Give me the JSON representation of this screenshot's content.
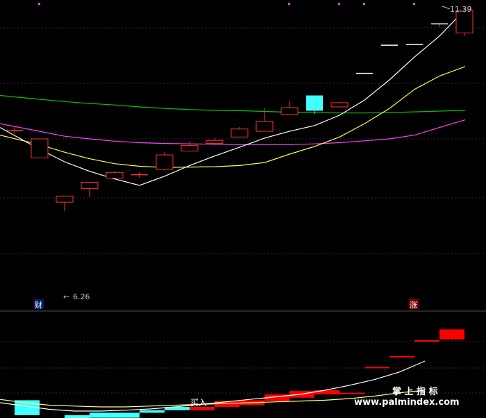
{
  "chart_data": {
    "type": "candlestick",
    "price_range": [
      4.0,
      11.6
    ],
    "candles": [
      {
        "o": 8.32,
        "h": 8.42,
        "l": 8.24,
        "c": 8.32
      },
      {
        "o": 7.6,
        "h": 8.1,
        "l": 7.6,
        "c": 8.1
      },
      {
        "o": 6.44,
        "h": 6.6,
        "l": 6.2,
        "c": 6.6
      },
      {
        "o": 6.8,
        "h": 6.96,
        "l": 6.58,
        "c": 6.96
      },
      {
        "o": 7.07,
        "h": 7.26,
        "l": 7.07,
        "c": 7.22
      },
      {
        "o": 7.16,
        "h": 7.23,
        "l": 7.07,
        "c": 7.16
      },
      {
        "o": 7.3,
        "h": 7.76,
        "l": 7.27,
        "c": 7.68
      },
      {
        "o": 7.78,
        "h": 8.04,
        "l": 7.77,
        "c": 7.93
      },
      {
        "o": 7.98,
        "h": 8.12,
        "l": 7.93,
        "c": 8.06
      },
      {
        "o": 8.15,
        "h": 8.41,
        "l": 8.14,
        "c": 8.36
      },
      {
        "o": 8.3,
        "h": 8.92,
        "l": 8.3,
        "c": 8.56
      },
      {
        "o": 8.74,
        "h": 9.1,
        "l": 8.74,
        "c": 8.92
      },
      {
        "o": 9.24,
        "h": 9.1,
        "l": 8.76,
        "c": 8.84
      },
      {
        "o": 8.94,
        "h": 9.07,
        "l": 8.94,
        "c": 9.05
      },
      {
        "o": 9.82,
        "h": 9.82,
        "l": 9.82,
        "c": 9.82
      },
      {
        "o": 10.56,
        "h": 10.56,
        "l": 10.56,
        "c": 10.56
      },
      {
        "o": 10.58,
        "h": 10.58,
        "l": 10.58,
        "c": 10.58
      },
      {
        "o": 11.12,
        "h": 11.12,
        "l": 11.04,
        "c": 11.12
      },
      {
        "o": 10.88,
        "h": 11.5,
        "l": 10.8,
        "c": 11.48
      }
    ],
    "ma_lines": [
      {
        "color": "#00c800",
        "values": [
          9.24,
          9.14,
          9.08,
          9.03,
          8.99,
          8.94,
          8.9,
          8.87,
          8.85,
          8.84,
          8.82,
          8.8,
          8.79,
          8.78,
          8.78,
          8.79,
          8.81,
          8.83,
          8.85
        ]
      },
      {
        "color": "#ff40ff",
        "values": [
          8.5,
          8.3,
          8.17,
          8.1,
          8.04,
          8.0,
          7.98,
          7.97,
          7.96,
          7.95,
          7.95,
          7.95,
          7.97,
          8.0,
          8.05,
          8.1,
          8.2,
          8.4,
          8.6
        ]
      },
      {
        "color": "#ffff40",
        "values": [
          8.2,
          7.95,
          7.75,
          7.58,
          7.45,
          7.38,
          7.35,
          7.36,
          7.37,
          7.4,
          7.48,
          7.7,
          7.9,
          8.15,
          8.5,
          8.9,
          9.4,
          9.75,
          10.0
        ]
      },
      {
        "color": "#ffffff",
        "values": [
          8.4,
          7.83,
          7.5,
          7.25,
          7.05,
          6.88,
          7.12,
          7.4,
          7.65,
          7.88,
          8.12,
          8.3,
          8.45,
          8.72,
          9.12,
          9.65,
          10.25,
          10.8,
          11.5
        ]
      }
    ],
    "annotations": {
      "high_label": "11.39",
      "low_label": "6.26",
      "low_arrow": "←",
      "badge_left": "财",
      "badge_right": "涨"
    },
    "lower_panel": {
      "signal_label": "买入",
      "bars": [
        {
          "color": "#40ffff",
          "v0": 0.0,
          "v1": 0.36
        },
        {
          "color": "#40ffff",
          "v0": -0.18,
          "v1": -0.08
        },
        {
          "color": "#40ffff",
          "v0": -0.12,
          "v1": 0.0
        },
        {
          "color": "#40ffff",
          "v0": -0.06,
          "v1": 0.06
        },
        {
          "color": "#40ffff",
          "v0": -0.06,
          "v1": 0.06
        },
        {
          "color": "#40ffff",
          "v0": 0.06,
          "v1": 0.12
        },
        {
          "color": "#40ffff",
          "v0": 0.12,
          "v1": 0.2
        },
        {
          "color": "#ff0000",
          "v0": 0.12,
          "v1": 0.2
        },
        {
          "color": "#ff0000",
          "v0": 0.2,
          "v1": 0.34
        },
        {
          "color": "#ff0000",
          "v0": 0.24,
          "v1": 0.36
        },
        {
          "color": "#ff0000",
          "v0": 0.34,
          "v1": 0.5
        },
        {
          "color": "#ff0000",
          "v0": 0.42,
          "v1": 0.58
        },
        {
          "color": "#ff0000",
          "v0": 0.5,
          "v1": 0.6
        },
        {
          "color": "#ff0000",
          "v0": 0.52,
          "v1": 0.54
        },
        {
          "color": "#ff0000",
          "v0": 1.14,
          "v1": 1.16
        },
        {
          "color": "#ff0000",
          "v0": 1.4,
          "v1": 1.42
        },
        {
          "color": "#ff0000",
          "v0": 1.78,
          "v1": 1.8
        },
        {
          "color": "#ff0000",
          "v0": 1.82,
          "v1": 2.06
        }
      ],
      "lines": [
        {
          "color": "#ffff80",
          "values": [
            0.38,
            0.3,
            0.24,
            0.22,
            0.2,
            0.2,
            0.22,
            0.24,
            0.26,
            0.28,
            0.3,
            0.32,
            0.34,
            0.36,
            0.4,
            0.46,
            0.54,
            0.6
          ]
        },
        {
          "color": "#ffffff",
          "values": [
            0.3,
            0.22,
            0.14,
            0.1,
            0.1,
            0.12,
            0.15,
            0.2,
            0.26,
            0.32,
            0.38,
            0.44,
            0.5,
            0.6,
            0.72,
            0.86,
            1.04,
            1.3
          ]
        }
      ]
    }
  },
  "watermark": {
    "title": "掌 上 指 标",
    "url": "www.palmindex.com"
  }
}
